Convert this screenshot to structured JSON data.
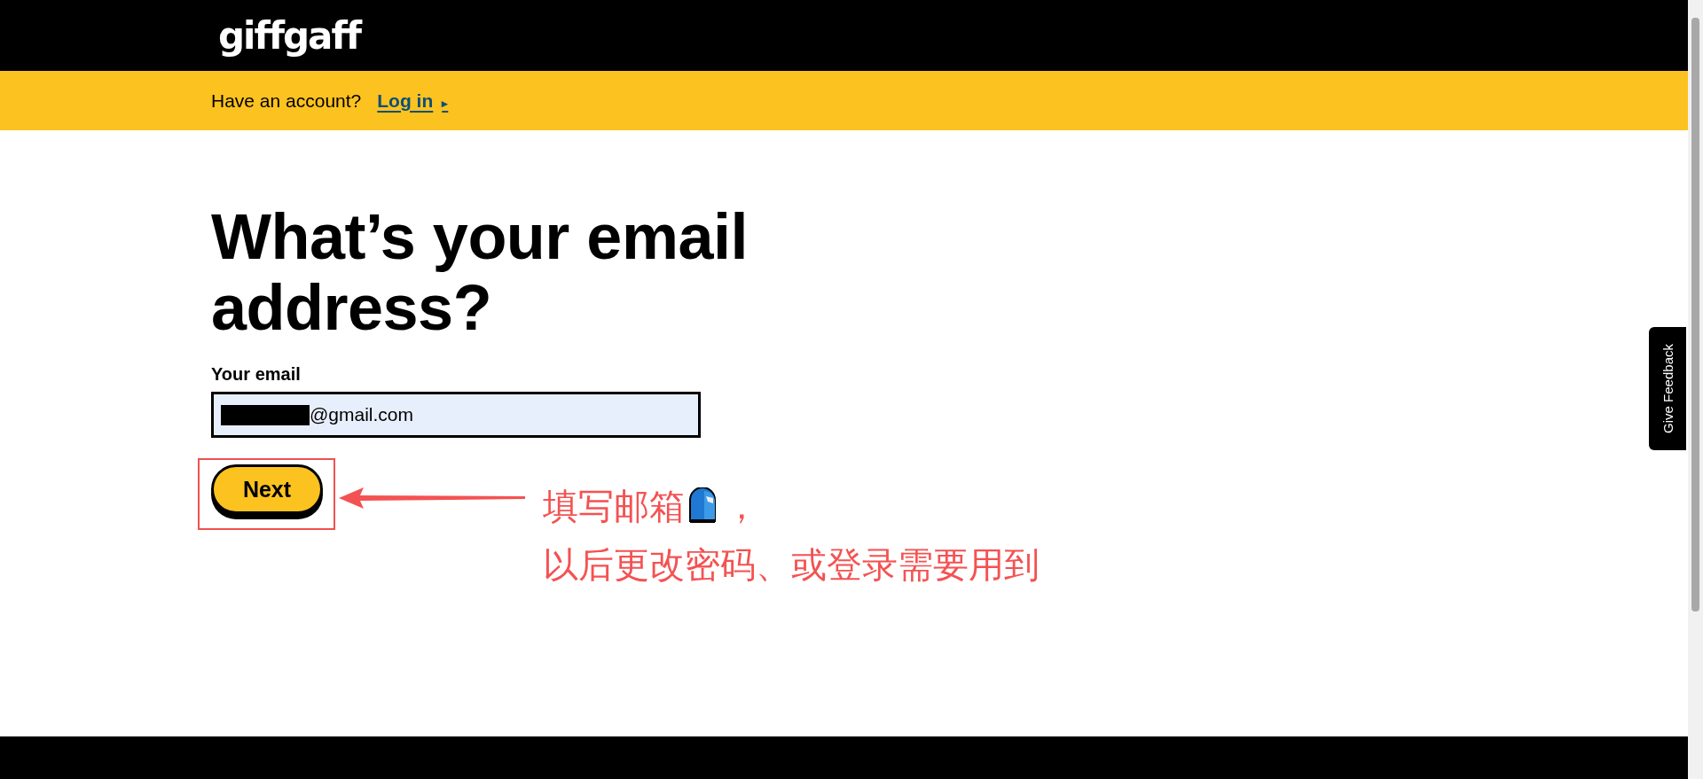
{
  "header": {
    "logo": "giffgaff"
  },
  "banner": {
    "prompt": "Have an account?",
    "link": "Log in",
    "link_arrow": "▸"
  },
  "form": {
    "title": "What’s your email address?",
    "field_label": "Your email",
    "email_value": "@gmail.com",
    "next_button": "Next"
  },
  "annotation": {
    "line_1": "填写邮箱",
    "line_1_end": "，",
    "line_2": "以后更改密码、或登录需要用到"
  },
  "feedback_tab": {
    "label": "Give Feedback"
  }
}
